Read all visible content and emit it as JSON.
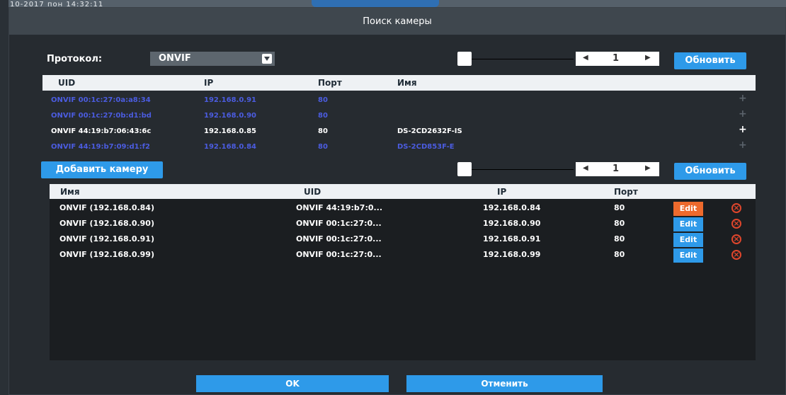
{
  "background": {
    "timestamp": "10-2017 пон 14:32:11"
  },
  "dialog": {
    "title": "Поиск камеры"
  },
  "protocol": {
    "label": "Протокол:",
    "value": "ONVIF"
  },
  "pager_top": {
    "page": "1",
    "prev_icon": "arrow-left-icon",
    "next_icon": "arrow-right-icon"
  },
  "refresh_label": "Обновить",
  "search_table": {
    "headers": [
      "UID",
      "IP",
      "Порт",
      "Имя"
    ],
    "rows": [
      {
        "uid": "ONVIF 00:1c:27:0a:a8:34",
        "ip": "192.168.0.91",
        "port": "80",
        "name": "",
        "added": true
      },
      {
        "uid": "ONVIF 00:1c:27:0b:d1:bd",
        "ip": "192.168.0.90",
        "port": "80",
        "name": "",
        "added": true
      },
      {
        "uid": "ONVIF 44:19:b7:06:43:6c",
        "ip": "192.168.0.85",
        "port": "80",
        "name": "DS-2CD2632F-IS",
        "added": false
      },
      {
        "uid": "ONVIF 44:19:b7:09:d1:f2",
        "ip": "192.168.0.84",
        "port": "80",
        "name": "DS-2CD853F-E",
        "added": true
      }
    ]
  },
  "add_camera_label": "Добавить камеру",
  "pager_bottom": {
    "page": "1"
  },
  "added_table": {
    "headers": [
      "Имя",
      "UID",
      "IP",
      "Порт"
    ],
    "rows": [
      {
        "name": "ONVIF (192.168.0.84)",
        "uid": "ONVIF 44:19:b7:0...",
        "ip": "192.168.0.84",
        "port": "80",
        "edit": "Edit",
        "edit_color": "#ee6a2d"
      },
      {
        "name": "ONVIF (192.168.0.90)",
        "uid": "ONVIF 00:1c:27:0...",
        "ip": "192.168.0.90",
        "port": "80",
        "edit": "Edit",
        "edit_color": "#2e9ae9"
      },
      {
        "name": "ONVIF (192.168.0.91)",
        "uid": "ONVIF 00:1c:27:0...",
        "ip": "192.168.0.91",
        "port": "80",
        "edit": "Edit",
        "edit_color": "#2e9ae9"
      },
      {
        "name": "ONVIF (192.168.0.99)",
        "uid": "ONVIF 00:1c:27:0...",
        "ip": "192.168.0.99",
        "port": "80",
        "edit": "Edit",
        "edit_color": "#2e9ae9"
      }
    ]
  },
  "ok_label": "OK",
  "cancel_label": "Отменить",
  "colors": {
    "accent": "#2e9ae9",
    "added_text": "#4b5ce0",
    "delete": "#e0462c"
  }
}
